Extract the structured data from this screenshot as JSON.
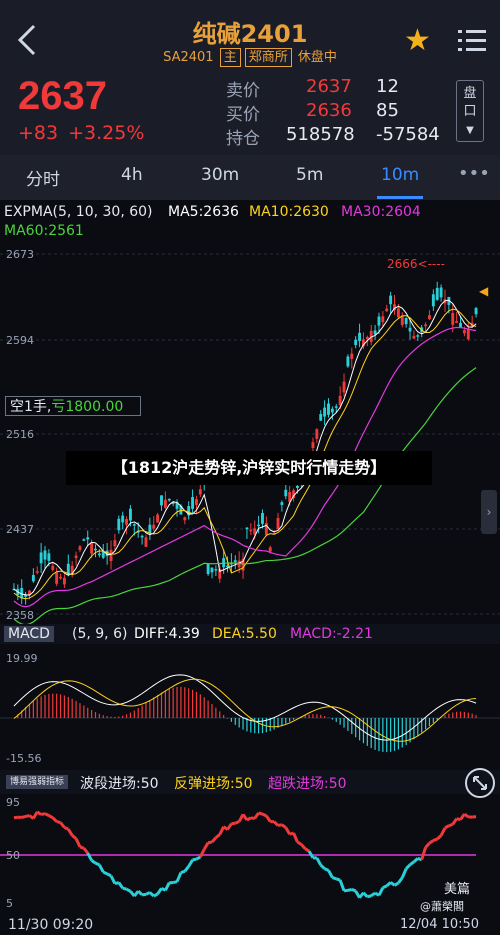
{
  "header": {
    "title": "纯碱2401",
    "code": "SA2401",
    "tag_main": "主",
    "exchange": "郑商所",
    "status": "休盘中",
    "last_price": "2637",
    "change": "+83",
    "change_pct": "+3.25%",
    "ask_label": "卖价",
    "ask_price": "2637",
    "ask_vol": "12",
    "bid_label": "买价",
    "bid_price": "2636",
    "bid_vol": "85",
    "oi_label": "持仓",
    "oi": "518578",
    "oi_change": "-57584",
    "pan_label": "盘口"
  },
  "tabs": [
    {
      "label": "分时"
    },
    {
      "label": "4h"
    },
    {
      "label": "30m"
    },
    {
      "label": "5m"
    },
    {
      "label": "10m",
      "active": true
    }
  ],
  "indicators": {
    "expma": "EXPMA(5, 10, 30, 60)",
    "ma5": "MA5:2636",
    "ma10": "MA10:2630",
    "ma30": "MA30:2604",
    "ma60": "MA60:2561",
    "price_ticks": [
      "2673",
      "2594",
      "2516",
      "2437",
      "2358"
    ],
    "marker": "2666<----",
    "kong": "空1手,",
    "kong_val": "亏1800.00",
    "banner": "【1812沪走势锌,沪锌实时行情走势】",
    "macd_tag": "MACD",
    "macd_params": "(5, 9, 6)",
    "diff": "DIFF:4.39",
    "dea": "DEA:5.50",
    "macd": "MACD:-2.21",
    "macd_ticks": [
      "19.99",
      "-15.56"
    ],
    "bo_tag": "博易强弱指标",
    "bo1": "波段进场:50",
    "bo2": "反弹进场:50",
    "bo3": "超跌进场:50",
    "bo_ticks": [
      "95",
      "50",
      "5"
    ],
    "time_start": "11/30 09:20",
    "time_end": "12/04 10:50",
    "watermark": "美篇",
    "watermark2": "@蕭榮閣"
  },
  "colors": {
    "up": "#f03a3a",
    "down": "#2ad0d8",
    "ma5": "#ffffff",
    "ma10": "#ffd21a",
    "ma30": "#e23ae0",
    "ma60": "#4ad43a",
    "accent": "#3a8bff"
  }
}
